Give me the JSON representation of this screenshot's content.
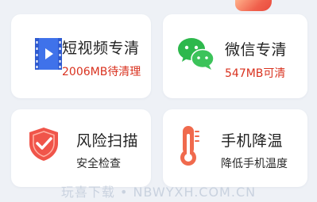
{
  "colors": {
    "accent": "#d9321f",
    "video_icon": "#3f72ea",
    "wechat_icon": "#2db84c",
    "shield_icon": "#f0554a",
    "thermo_icon": "#f06a4d"
  },
  "cards": [
    {
      "icon": "video-play-icon",
      "title": "短视频专清",
      "subtitle": "2006MB待清理"
    },
    {
      "icon": "wechat-icon",
      "title": "微信专清",
      "subtitle": "547MB可清"
    },
    {
      "icon": "shield-check-icon",
      "title": "风险扫描",
      "subtitle": "安全检查"
    },
    {
      "icon": "thermometer-icon",
      "title": "手机降温",
      "subtitle": "降低手机温度"
    }
  ],
  "watermark": "玩喜下载 • NBWYXH.COM.CN"
}
